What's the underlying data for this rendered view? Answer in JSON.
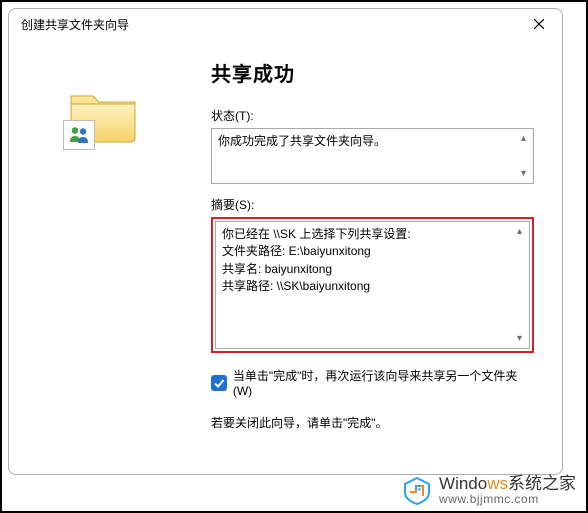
{
  "window": {
    "title": "创建共享文件夹向导"
  },
  "main": {
    "heading": "共享成功",
    "status_label": "状态(T):",
    "status_text": "你成功完成了共享文件夹向导。",
    "summary_label": "摘要(S):",
    "summary_text": "你已经在 \\\\SK 上选择下列共享设置:\n文件夹路径: E:\\baiyunxitong\n共享名: baiyunxitong\n共享路径: \\\\SK\\baiyunxitong",
    "checkbox_label": "当单击\"完成\"时，再次运行该向导来共享另一个文件夹(W)",
    "closing_text": "若要关闭此向导，请单击\"完成\"。"
  },
  "icons": {
    "folder": "shared-folder-icon",
    "close": "close-icon",
    "scroll_up": "▴",
    "scroll_down": "▾"
  },
  "watermark": {
    "brand_plain": "Windo",
    "brand_accent": "ws",
    "tagline": "系统之家",
    "url": "www.bjjmmc.com"
  }
}
